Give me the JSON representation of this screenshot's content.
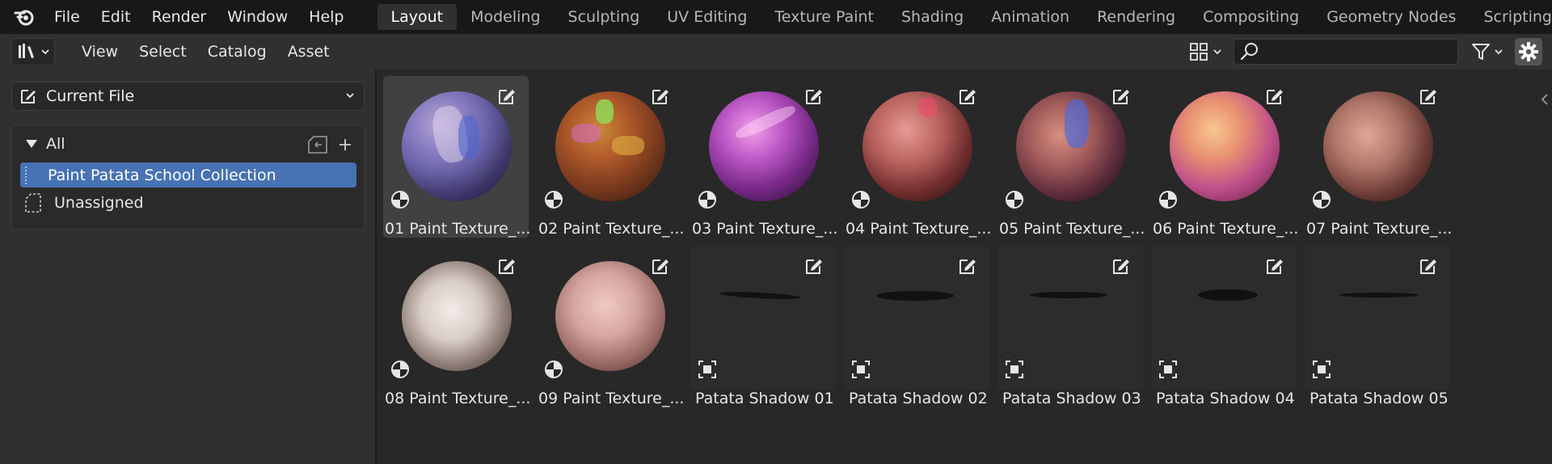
{
  "top_menu": [
    "File",
    "Edit",
    "Render",
    "Window",
    "Help"
  ],
  "workspaces": [
    "Layout",
    "Modeling",
    "Sculpting",
    "UV Editing",
    "Texture Paint",
    "Shading",
    "Animation",
    "Rendering",
    "Compositing",
    "Geometry Nodes",
    "Scripting"
  ],
  "active_workspace": "Layout",
  "workspace_more": "+",
  "header_menu": [
    "View",
    "Select",
    "Catalog",
    "Asset"
  ],
  "search": {
    "value": "",
    "placeholder": ""
  },
  "library": {
    "label": "Current File"
  },
  "catalogs": {
    "all_label": "All",
    "items": [
      {
        "label": "Paint Patata School Collection",
        "selected": true
      },
      {
        "label": "Unassigned",
        "selected": false
      }
    ]
  },
  "assets": [
    {
      "name": "01 Paint Texture_...",
      "kind": "material",
      "selected": true
    },
    {
      "name": "02 Paint Texture_...",
      "kind": "material",
      "selected": false
    },
    {
      "name": "03 Paint Texture_...",
      "kind": "material",
      "selected": false
    },
    {
      "name": "04 Paint Texture_...",
      "kind": "material",
      "selected": false
    },
    {
      "name": "05 Paint Texture_...",
      "kind": "material",
      "selected": false
    },
    {
      "name": "06 Paint Texture_...",
      "kind": "material",
      "selected": false
    },
    {
      "name": "07 Paint Texture_...",
      "kind": "material",
      "selected": false
    },
    {
      "name": "08 Paint Texture_...",
      "kind": "material",
      "selected": false
    },
    {
      "name": "09 Paint Texture_...",
      "kind": "material",
      "selected": false
    },
    {
      "name": "Patata Shadow 01",
      "kind": "object",
      "selected": false
    },
    {
      "name": "Patata Shadow 02",
      "kind": "object",
      "selected": false
    },
    {
      "name": "Patata Shadow 03",
      "kind": "object",
      "selected": false
    },
    {
      "name": "Patata Shadow 04",
      "kind": "object",
      "selected": false
    },
    {
      "name": "Patata Shadow 05",
      "kind": "object",
      "selected": false
    }
  ],
  "colors": {
    "accent": "#4772b3",
    "panel": "#303030",
    "grid_bg": "#282828"
  }
}
